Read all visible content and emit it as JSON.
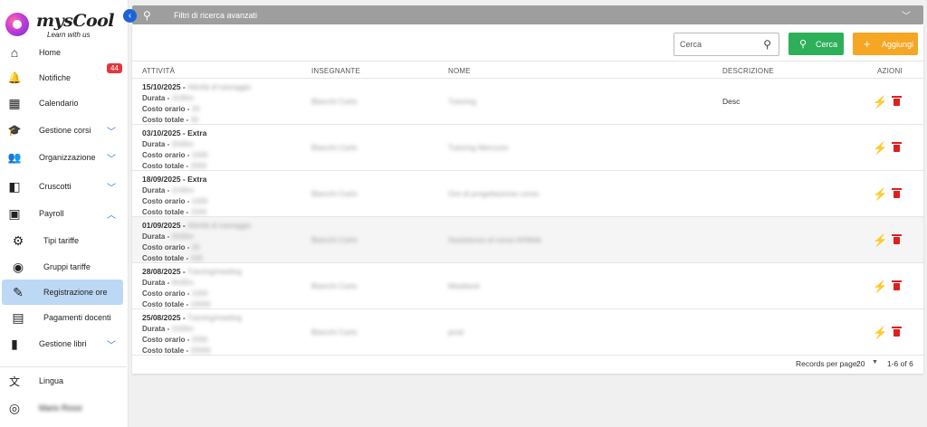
{
  "app": {
    "logo_text": "mysCool",
    "logo_tagline": "Learn with us"
  },
  "sidebar": {
    "items": [
      {
        "label": "Home",
        "icon": "home-icon",
        "glyph": "⌂"
      },
      {
        "label": "Notifiche",
        "icon": "bell-icon",
        "glyph": "🔔",
        "badge": "44"
      },
      {
        "label": "Calendario",
        "icon": "calendar-icon",
        "glyph": "▦"
      },
      {
        "label": "Gestione corsi",
        "icon": "graduation-cap-icon",
        "glyph": "🎓"
      },
      {
        "label": "Organizzazione",
        "icon": "users-settings-icon",
        "glyph": "👥"
      },
      {
        "label": "Cruscotti",
        "icon": "dashboard-icon",
        "glyph": "◧"
      },
      {
        "label": "Payroll",
        "icon": "wallet-icon",
        "glyph": "▣"
      },
      {
        "label": "Tipi tariffe",
        "icon": "gears-icon",
        "glyph": "⚙"
      },
      {
        "label": "Gruppi tariffe",
        "icon": "group-circle-icon",
        "glyph": "◉"
      },
      {
        "label": "Registrazione ore",
        "icon": "edit-note-icon",
        "glyph": "✎"
      },
      {
        "label": "Pagamenti docenti",
        "icon": "payments-icon",
        "glyph": "▤"
      },
      {
        "label": "Gestione libri",
        "icon": "book-icon",
        "glyph": "▮"
      },
      {
        "label": "Lingua",
        "icon": "translate-icon",
        "glyph": "文"
      },
      {
        "label": "Mario Rossi",
        "icon": "account-icon",
        "glyph": "◎"
      }
    ]
  },
  "filters": {
    "label": "Filtri di ricerca avanzati"
  },
  "toolbar": {
    "search_placeholder": "Cerca",
    "search_label": "Cerca",
    "add_label": "Aggiungi"
  },
  "table": {
    "headers": [
      "ATTIVITÀ",
      "INSEGNANTE",
      "NOME",
      "DESCRIZIONE",
      "AZIONI"
    ],
    "field_labels": {
      "duration": "Durata - ",
      "hourly": "Costo orario - ",
      "total": "Costo totale - "
    },
    "rows": [
      {
        "date": "15/10/2025 - ",
        "activity": "Attività di tutoraggio",
        "duration": "1h30m",
        "hourly": "20",
        "total": "30",
        "teacher": "Bianchi Carlo",
        "name": "Tutoring",
        "description": "Desc"
      },
      {
        "date": "03/10/2025 - Extra",
        "activity": "",
        "duration": "2h00m",
        "hourly": "1000",
        "total": "2000",
        "teacher": "Bianchi Carlo",
        "name": "Tutoring Mercurio",
        "description": ""
      },
      {
        "date": "18/09/2025 - Extra",
        "activity": "",
        "duration": "1h30m",
        "hourly": "1000",
        "total": "1500",
        "teacher": "Bianchi Carlo",
        "name": "Ore di progettazione corso",
        "description": ""
      },
      {
        "date": "01/09/2025 - ",
        "activity": "Attività di tutoraggio",
        "duration": "2h00m",
        "hourly": "20",
        "total": "100",
        "teacher": "Bianchi Carlo",
        "name": "Assistenza al corso AI/Web",
        "description": ""
      },
      {
        "date": "28/08/2025 - ",
        "activity": "Tutoring/meeting",
        "duration": "0h30m",
        "hourly": "1000",
        "total": "10000",
        "teacher": "Bianchi Carlo",
        "name": "Mastland",
        "description": ""
      },
      {
        "date": "25/08/2025 - ",
        "activity": "Tutoring/meeting",
        "duration": "1h00m",
        "hourly": "2000",
        "total": "20000",
        "teacher": "Bianchi Carlo",
        "name": "prod",
        "description": ""
      }
    ]
  },
  "pagination": {
    "records_label": "Records per page:",
    "per_page": "20",
    "range": "1-6 of 6"
  },
  "colors": {
    "accent": "#1e63d6",
    "active_bg": "#bcd8f5",
    "search_green": "#2eb05a",
    "add_orange": "#f5a623",
    "bolt": "#f5b800",
    "trash": "#e01e1e",
    "badge": "#e0383e"
  }
}
